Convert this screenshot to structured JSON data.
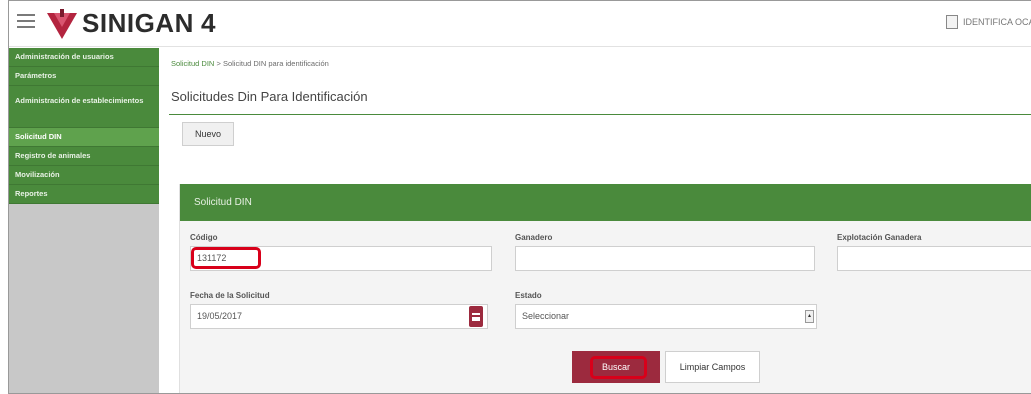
{
  "header": {
    "brand": "SINIGAN",
    "version": "4",
    "user_label": "IDENTIFICA OCAÑ"
  },
  "sidebar": {
    "items": [
      {
        "label": "Administración de usuarios"
      },
      {
        "label": "Parámetros"
      },
      {
        "label": "Administración de establecimientos"
      },
      {
        "label": "Solicitud DIN"
      },
      {
        "label": "Registro de animales"
      },
      {
        "label": "Movilización"
      },
      {
        "label": "Reportes"
      }
    ]
  },
  "breadcrumb": {
    "root": "Solicitud DIN",
    "separator": ">",
    "current": "Solicitud DIN para identificación"
  },
  "page": {
    "title": "Solicitudes Din Para Identificación",
    "new_button": "Nuevo"
  },
  "form": {
    "panel_title": "Solicitud DIN",
    "codigo": {
      "label": "Código",
      "value": "131172"
    },
    "ganadero": {
      "label": "Ganadero",
      "value": ""
    },
    "explotacion": {
      "label": "Explotación Ganadera",
      "value": ""
    },
    "fecha": {
      "label": "Fecha de la Solicitud",
      "value": "19/05/2017"
    },
    "estado": {
      "label": "Estado",
      "selected": "Seleccionar"
    },
    "search_button": "Buscar",
    "clear_button": "Limpiar Campos"
  },
  "colors": {
    "accent_green": "#4a8a3c",
    "button_maroon": "#9c2a3e",
    "highlight_red": "#d8001a"
  }
}
